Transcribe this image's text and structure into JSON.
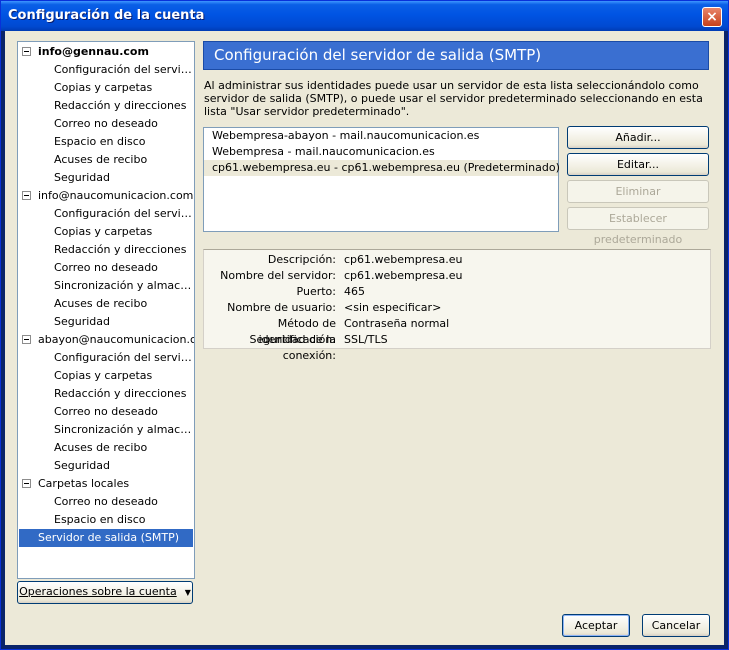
{
  "window": {
    "title": "Configuración de la cuenta",
    "close_label": "×"
  },
  "tree": [
    {
      "label": "info@gennau.com",
      "level": 0,
      "bold": true
    },
    {
      "label": "Configuración del servidor",
      "level": 1
    },
    {
      "label": "Copias y carpetas",
      "level": 1
    },
    {
      "label": "Redacción y direcciones",
      "level": 1
    },
    {
      "label": "Correo no deseado",
      "level": 1
    },
    {
      "label": "Espacio en disco",
      "level": 1
    },
    {
      "label": "Acuses de recibo",
      "level": 1
    },
    {
      "label": "Seguridad",
      "level": 1
    },
    {
      "label": "info@naucomunicacion.com",
      "level": 0
    },
    {
      "label": "Configuración del servidor",
      "level": 1
    },
    {
      "label": "Copias y carpetas",
      "level": 1
    },
    {
      "label": "Redacción y direcciones",
      "level": 1
    },
    {
      "label": "Correo no deseado",
      "level": 1
    },
    {
      "label": "Sincronización y almacena...",
      "level": 1
    },
    {
      "label": "Acuses de recibo",
      "level": 1
    },
    {
      "label": "Seguridad",
      "level": 1
    },
    {
      "label": "abayon@naucomunicacion.com",
      "level": 0
    },
    {
      "label": "Configuración del servidor",
      "level": 1
    },
    {
      "label": "Copias y carpetas",
      "level": 1
    },
    {
      "label": "Redacción y direcciones",
      "level": 1
    },
    {
      "label": "Correo no deseado",
      "level": 1
    },
    {
      "label": "Sincronización y almacena...",
      "level": 1
    },
    {
      "label": "Acuses de recibo",
      "level": 1
    },
    {
      "label": "Seguridad",
      "level": 1
    },
    {
      "label": "Carpetas locales",
      "level": 0
    },
    {
      "label": "Correo no deseado",
      "level": 1
    },
    {
      "label": "Espacio en disco",
      "level": 1
    },
    {
      "label": "Servidor de salida (SMTP)",
      "level": 0,
      "selected": true
    }
  ],
  "account_ops_label": "Operaciones sobre la cuenta",
  "panel": {
    "title": "Configuración del servidor de salida (SMTP)",
    "description": "Al administrar sus identidades puede usar un servidor de esta lista seleccionándolo como servidor de salida (SMTP), o puede usar el servidor predeterminado seleccionando en esta lista \"Usar servidor predeterminado\".",
    "servers": [
      "Webempresa-abayon - mail.naucomunicacion.es",
      "Webempresa - mail.naucomunicacion.es",
      "cp61.webempresa.eu - cp61.webempresa.eu (Predeterminado)"
    ],
    "buttons": {
      "add": "Añadir...",
      "edit": "Editar...",
      "remove": "Eliminar",
      "set_default": "Establecer predeterminado"
    },
    "details": [
      {
        "label": "Descripción:",
        "value": "cp61.webempresa.eu"
      },
      {
        "label": "Nombre del servidor:",
        "value": "cp61.webempresa.eu"
      },
      {
        "label": "Puerto:",
        "value": "465"
      },
      {
        "label": "Nombre de usuario:",
        "value": "<sin especificar>"
      },
      {
        "label": "Método de identificación:",
        "value": "Contraseña normal"
      },
      {
        "label": "Seguridad de la conexión:",
        "value": "SSL/TLS"
      }
    ]
  },
  "footer": {
    "ok": "Aceptar",
    "cancel": "Cancelar"
  }
}
